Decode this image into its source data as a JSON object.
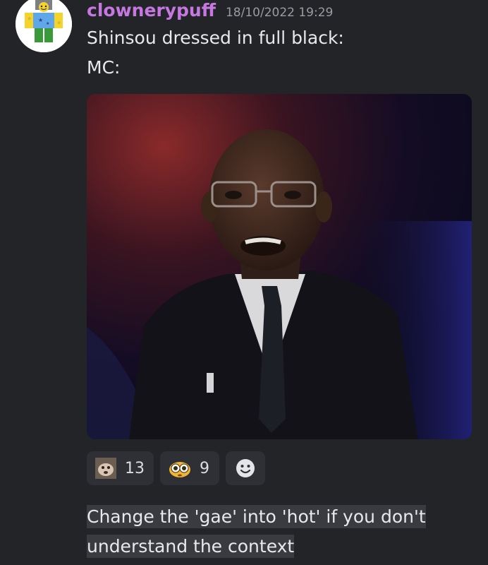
{
  "message": {
    "username": "clownerypuff",
    "timestamp": "18/10/2022 19:29",
    "lines": [
      "Shinsou dressed in full black:",
      "MC:"
    ],
    "username_color": "#c678e0",
    "avatar": "roblox-avatar-icon"
  },
  "attachment": {
    "type": "image",
    "icon": "photo-man-in-black-suit"
  },
  "reactions": [
    {
      "icon": "custom-emoji-dog-face-icon",
      "count": "13"
    },
    {
      "icon": "flushed-eyes-emoji-icon",
      "count": "9"
    },
    {
      "icon": "add-reaction-smiley-icon",
      "count": null
    }
  ],
  "followup": {
    "line1": "Change the 'gae' into 'hot' if you don't",
    "line2": "understand the context"
  },
  "colors": {
    "background": "#232428",
    "reaction_bg": "#2f3036",
    "highlight_bg": "#3a3b41"
  }
}
